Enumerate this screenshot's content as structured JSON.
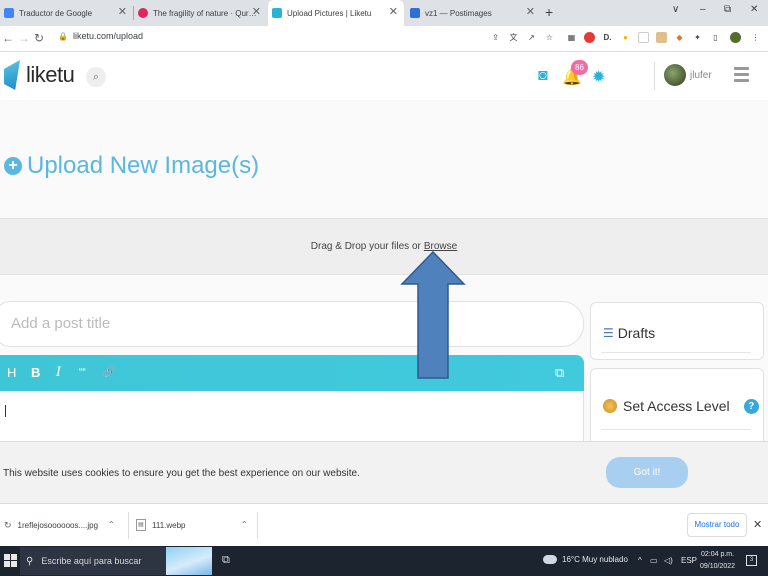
{
  "browser": {
    "tabs": [
      {
        "title": "Traductor de Google",
        "active": false,
        "favicon_color": "#4285f4"
      },
      {
        "title": "The fragility of nature · Qurator's",
        "active": false,
        "favicon_color": "#e0245e"
      },
      {
        "title": "Upload Pictures | Liketu",
        "active": true,
        "favicon_color": "#2bb3d6"
      },
      {
        "title": "vz1 — Postimages",
        "active": false,
        "favicon_color": "#2d6fd6"
      }
    ],
    "new_tab": "+",
    "window_controls": {
      "dropdown": "∨",
      "minimize": "–",
      "restore": "⧉",
      "close": "✕"
    },
    "url": "liketu.com/upload"
  },
  "site": {
    "logo_text": "liketu",
    "notification_count": "86",
    "username": "jlufer",
    "accent_color": "#2bb3d6"
  },
  "upload": {
    "heading": "Upload New Image(s)",
    "drop_text": "Drag & Drop your files or",
    "browse_label": "Browse"
  },
  "editor": {
    "title_placeholder": "Add a post title",
    "toolbar": {
      "heading": "H",
      "bold": "B",
      "italic": "I",
      "quote": "““",
      "link": "🔗"
    }
  },
  "sidebar": {
    "drafts_label": "Drafts",
    "access_label": "Set Access Level",
    "help": "?"
  },
  "cookie": {
    "message": "This website uses cookies to ensure you get the best experience on our website.",
    "button": "Got it!"
  },
  "downloads": {
    "items": [
      {
        "name": "1reflejosoooooos....jpg"
      },
      {
        "name": "111.webp"
      }
    ],
    "show_all": "Mostrar todo"
  },
  "taskbar": {
    "search_placeholder": "Escribe aquí para buscar",
    "weather": "16°C  Muy nublado",
    "language": "ESP",
    "time": "02:04 p.m.",
    "date": "09/10/2022",
    "notification_count": "3"
  }
}
